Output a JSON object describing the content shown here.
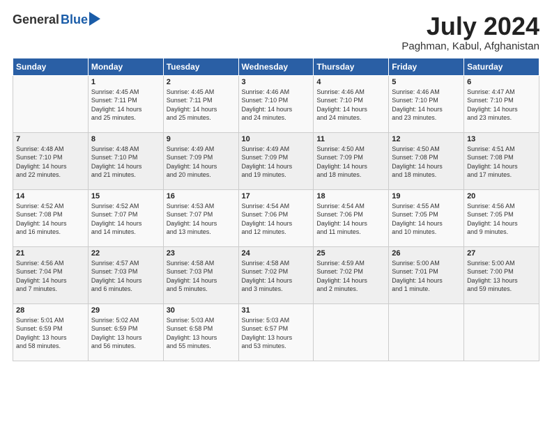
{
  "logo": {
    "general": "General",
    "blue": "Blue"
  },
  "title": {
    "month_year": "July 2024",
    "location": "Paghman, Kabul, Afghanistan"
  },
  "headers": [
    "Sunday",
    "Monday",
    "Tuesday",
    "Wednesday",
    "Thursday",
    "Friday",
    "Saturday"
  ],
  "weeks": [
    [
      {
        "day": "",
        "lines": []
      },
      {
        "day": "1",
        "lines": [
          "Sunrise: 4:45 AM",
          "Sunset: 7:11 PM",
          "Daylight: 14 hours",
          "and 25 minutes."
        ]
      },
      {
        "day": "2",
        "lines": [
          "Sunrise: 4:45 AM",
          "Sunset: 7:11 PM",
          "Daylight: 14 hours",
          "and 25 minutes."
        ]
      },
      {
        "day": "3",
        "lines": [
          "Sunrise: 4:46 AM",
          "Sunset: 7:10 PM",
          "Daylight: 14 hours",
          "and 24 minutes."
        ]
      },
      {
        "day": "4",
        "lines": [
          "Sunrise: 4:46 AM",
          "Sunset: 7:10 PM",
          "Daylight: 14 hours",
          "and 24 minutes."
        ]
      },
      {
        "day": "5",
        "lines": [
          "Sunrise: 4:46 AM",
          "Sunset: 7:10 PM",
          "Daylight: 14 hours",
          "and 23 minutes."
        ]
      },
      {
        "day": "6",
        "lines": [
          "Sunrise: 4:47 AM",
          "Sunset: 7:10 PM",
          "Daylight: 14 hours",
          "and 23 minutes."
        ]
      }
    ],
    [
      {
        "day": "7",
        "lines": [
          "Sunrise: 4:48 AM",
          "Sunset: 7:10 PM",
          "Daylight: 14 hours",
          "and 22 minutes."
        ]
      },
      {
        "day": "8",
        "lines": [
          "Sunrise: 4:48 AM",
          "Sunset: 7:10 PM",
          "Daylight: 14 hours",
          "and 21 minutes."
        ]
      },
      {
        "day": "9",
        "lines": [
          "Sunrise: 4:49 AM",
          "Sunset: 7:09 PM",
          "Daylight: 14 hours",
          "and 20 minutes."
        ]
      },
      {
        "day": "10",
        "lines": [
          "Sunrise: 4:49 AM",
          "Sunset: 7:09 PM",
          "Daylight: 14 hours",
          "and 19 minutes."
        ]
      },
      {
        "day": "11",
        "lines": [
          "Sunrise: 4:50 AM",
          "Sunset: 7:09 PM",
          "Daylight: 14 hours",
          "and 18 minutes."
        ]
      },
      {
        "day": "12",
        "lines": [
          "Sunrise: 4:50 AM",
          "Sunset: 7:08 PM",
          "Daylight: 14 hours",
          "and 18 minutes."
        ]
      },
      {
        "day": "13",
        "lines": [
          "Sunrise: 4:51 AM",
          "Sunset: 7:08 PM",
          "Daylight: 14 hours",
          "and 17 minutes."
        ]
      }
    ],
    [
      {
        "day": "14",
        "lines": [
          "Sunrise: 4:52 AM",
          "Sunset: 7:08 PM",
          "Daylight: 14 hours",
          "and 16 minutes."
        ]
      },
      {
        "day": "15",
        "lines": [
          "Sunrise: 4:52 AM",
          "Sunset: 7:07 PM",
          "Daylight: 14 hours",
          "and 14 minutes."
        ]
      },
      {
        "day": "16",
        "lines": [
          "Sunrise: 4:53 AM",
          "Sunset: 7:07 PM",
          "Daylight: 14 hours",
          "and 13 minutes."
        ]
      },
      {
        "day": "17",
        "lines": [
          "Sunrise: 4:54 AM",
          "Sunset: 7:06 PM",
          "Daylight: 14 hours",
          "and 12 minutes."
        ]
      },
      {
        "day": "18",
        "lines": [
          "Sunrise: 4:54 AM",
          "Sunset: 7:06 PM",
          "Daylight: 14 hours",
          "and 11 minutes."
        ]
      },
      {
        "day": "19",
        "lines": [
          "Sunrise: 4:55 AM",
          "Sunset: 7:05 PM",
          "Daylight: 14 hours",
          "and 10 minutes."
        ]
      },
      {
        "day": "20",
        "lines": [
          "Sunrise: 4:56 AM",
          "Sunset: 7:05 PM",
          "Daylight: 14 hours",
          "and 9 minutes."
        ]
      }
    ],
    [
      {
        "day": "21",
        "lines": [
          "Sunrise: 4:56 AM",
          "Sunset: 7:04 PM",
          "Daylight: 14 hours",
          "and 7 minutes."
        ]
      },
      {
        "day": "22",
        "lines": [
          "Sunrise: 4:57 AM",
          "Sunset: 7:03 PM",
          "Daylight: 14 hours",
          "and 6 minutes."
        ]
      },
      {
        "day": "23",
        "lines": [
          "Sunrise: 4:58 AM",
          "Sunset: 7:03 PM",
          "Daylight: 14 hours",
          "and 5 minutes."
        ]
      },
      {
        "day": "24",
        "lines": [
          "Sunrise: 4:58 AM",
          "Sunset: 7:02 PM",
          "Daylight: 14 hours",
          "and 3 minutes."
        ]
      },
      {
        "day": "25",
        "lines": [
          "Sunrise: 4:59 AM",
          "Sunset: 7:02 PM",
          "Daylight: 14 hours",
          "and 2 minutes."
        ]
      },
      {
        "day": "26",
        "lines": [
          "Sunrise: 5:00 AM",
          "Sunset: 7:01 PM",
          "Daylight: 14 hours",
          "and 1 minute."
        ]
      },
      {
        "day": "27",
        "lines": [
          "Sunrise: 5:00 AM",
          "Sunset: 7:00 PM",
          "Daylight: 13 hours",
          "and 59 minutes."
        ]
      }
    ],
    [
      {
        "day": "28",
        "lines": [
          "Sunrise: 5:01 AM",
          "Sunset: 6:59 PM",
          "Daylight: 13 hours",
          "and 58 minutes."
        ]
      },
      {
        "day": "29",
        "lines": [
          "Sunrise: 5:02 AM",
          "Sunset: 6:59 PM",
          "Daylight: 13 hours",
          "and 56 minutes."
        ]
      },
      {
        "day": "30",
        "lines": [
          "Sunrise: 5:03 AM",
          "Sunset: 6:58 PM",
          "Daylight: 13 hours",
          "and 55 minutes."
        ]
      },
      {
        "day": "31",
        "lines": [
          "Sunrise: 5:03 AM",
          "Sunset: 6:57 PM",
          "Daylight: 13 hours",
          "and 53 minutes."
        ]
      },
      {
        "day": "",
        "lines": []
      },
      {
        "day": "",
        "lines": []
      },
      {
        "day": "",
        "lines": []
      }
    ]
  ]
}
